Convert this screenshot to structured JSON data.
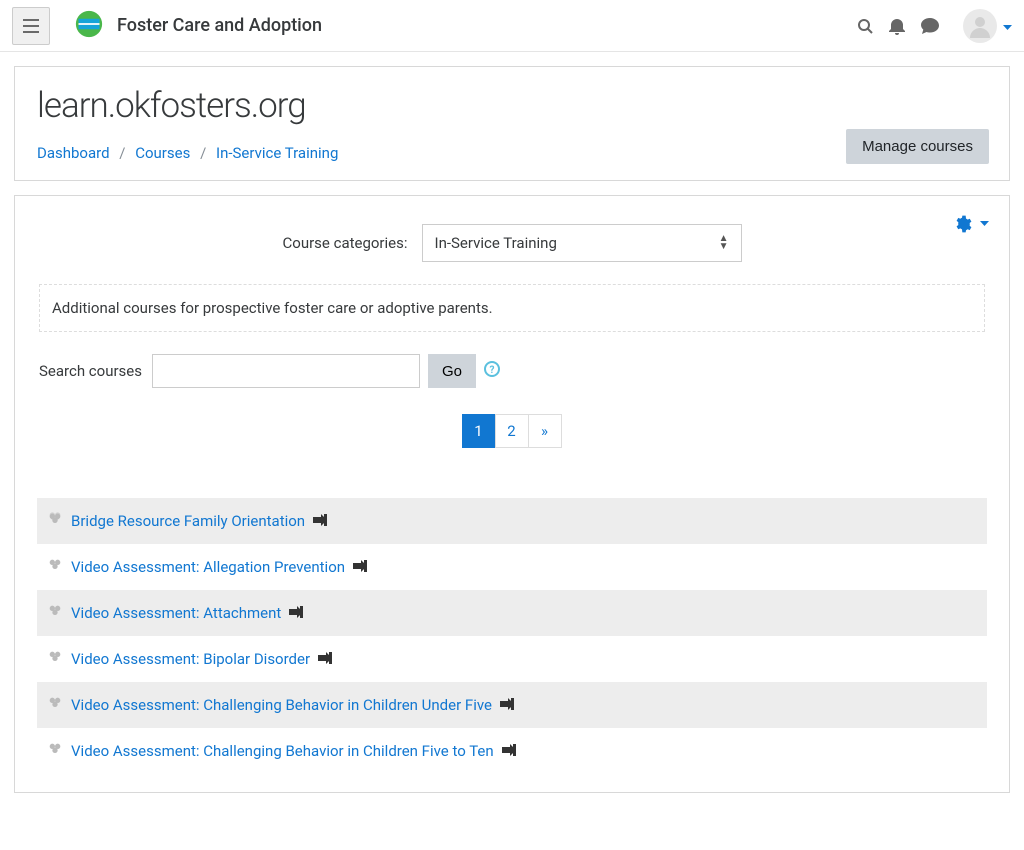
{
  "header": {
    "site_title": "Foster Care and Adoption"
  },
  "page": {
    "title": "learn.okfosters.org",
    "breadcrumb": {
      "dashboard": "Dashboard",
      "courses": "Courses",
      "current": "In-Service Training"
    },
    "manage_button": "Manage courses"
  },
  "category": {
    "label": "Course categories:",
    "selected": "In-Service Training",
    "description": "Additional courses for prospective foster care or adoptive parents."
  },
  "search": {
    "label": "Search courses",
    "go": "Go"
  },
  "pagination": {
    "page1": "1",
    "page2": "2",
    "next": "»"
  },
  "courses": [
    {
      "title": "Bridge Resource Family Orientation"
    },
    {
      "title": "Video Assessment: Allegation Prevention"
    },
    {
      "title": "Video Assessment: Attachment"
    },
    {
      "title": "Video Assessment: Bipolar Disorder"
    },
    {
      "title": "Video Assessment: Challenging Behavior in Children Under Five"
    },
    {
      "title": "Video Assessment: Challenging Behavior in Children Five to Ten"
    }
  ]
}
